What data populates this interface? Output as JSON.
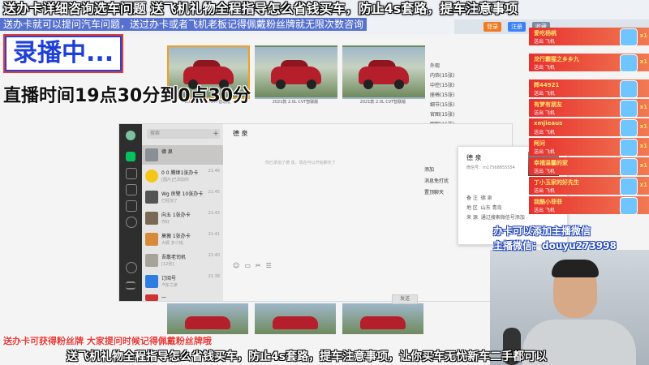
{
  "banner": {
    "line1": "送办卡详细咨询选车问题  送飞机礼物全程指导怎么省钱买车，防止4s套路，提车注意事项",
    "line2": "送办卡就可以提问汽车问题，送过办卡或者飞机老板记得佩戴粉丝牌就无限次数咨询"
  },
  "recording": {
    "label": "录播中..."
  },
  "schedule": {
    "text": "直播时间19点30分到0点30分"
  },
  "browser": {
    "btn1": "登录",
    "btn2": "注册",
    "btn3": "收藏"
  },
  "cars": [
    {
      "caption": "2021款 2.0L CVT智联版"
    },
    {
      "caption": "2021款 2.0L CVT智联版"
    },
    {
      "caption": "2021款 2.0L CVT智联版"
    }
  ],
  "speclist": [
    "外观",
    "内饰(15张)",
    "中控(15张)",
    "座椅(15张)",
    "细节(15张)",
    "官图(15张)",
    "图解(15张)"
  ],
  "wechat": {
    "search_placeholder": "搜索",
    "plus": "+",
    "title": "德 泉",
    "system_msg": "你已添加了德 泉，现在可以开始聊天了",
    "send": "发送",
    "side_items": [
      "添加",
      "消息免打扰",
      "置顶聊天"
    ],
    "chats": [
      {
        "name": "德 泉",
        "preview": "",
        "time": "",
        "active": true
      },
      {
        "name": "0 0 腾继1张办卡",
        "preview": "[图片]已添加你",
        "time": "21:46"
      },
      {
        "name": "Wg 房警 10张办卡",
        "preview": "已经加了",
        "time": "21:45"
      },
      {
        "name": "向五 1张办卡",
        "preview": "你好",
        "time": "21:43"
      },
      {
        "name": "莫薇 1张办卡",
        "preview": "大概 多少钱",
        "time": "21:41"
      },
      {
        "name": "吾散老司机",
        "preview": "[12张]",
        "time": "21:40"
      },
      {
        "name": "订阅号",
        "preview": "汽车之家",
        "time": "21:38"
      },
      {
        "name": "一",
        "preview": "",
        "time": "21:37"
      }
    ]
  },
  "card": {
    "name": "德 泉",
    "wechat_id": "微信号：m17568855554",
    "rows": [
      {
        "k": "备 注",
        "v": "德 泉"
      },
      {
        "k": "地 区",
        "v": "山东 青岛"
      },
      {
        "k": "来 源",
        "v": "通过搜索微信号添加"
      }
    ]
  },
  "gifts": [
    {
      "name": "爱吃杨桃",
      "desc": "送出 飞机",
      "count": "x1"
    },
    {
      "name": "龙行霸猩之乡乡九",
      "desc": "送出 飞机",
      "count": "x1"
    },
    {
      "name": "辉44921",
      "desc": "送出 飞机",
      "count": ""
    },
    {
      "name": "有梦有朋友",
      "desc": "送出 飞机",
      "count": "x1"
    },
    {
      "name": "xmjieaus",
      "desc": "送出 飞机",
      "count": "x1"
    },
    {
      "name": "阿问",
      "desc": "送出 飞机",
      "count": "x1"
    },
    {
      "name": "幸福温馨的家",
      "desc": "送出 飞机",
      "count": "x1"
    },
    {
      "name": "丁小玉家的好先生",
      "desc": "送出 飞机",
      "count": "x1"
    },
    {
      "name": "我酷小菲菲",
      "desc": "送出 飞机",
      "count": ""
    }
  ],
  "contact": {
    "line1": "办卡可以添加主播微信",
    "line2": "主播微信：douyu273998"
  },
  "tip": {
    "text": "送办卡可获得粉丝牌  大家提问时候记得佩戴粉丝牌哦"
  },
  "ticker": {
    "text": "送飞机礼物全程指导怎么省钱买车，防止4s套路，提车注意事项，让你买车无忧新车二手都可以"
  }
}
